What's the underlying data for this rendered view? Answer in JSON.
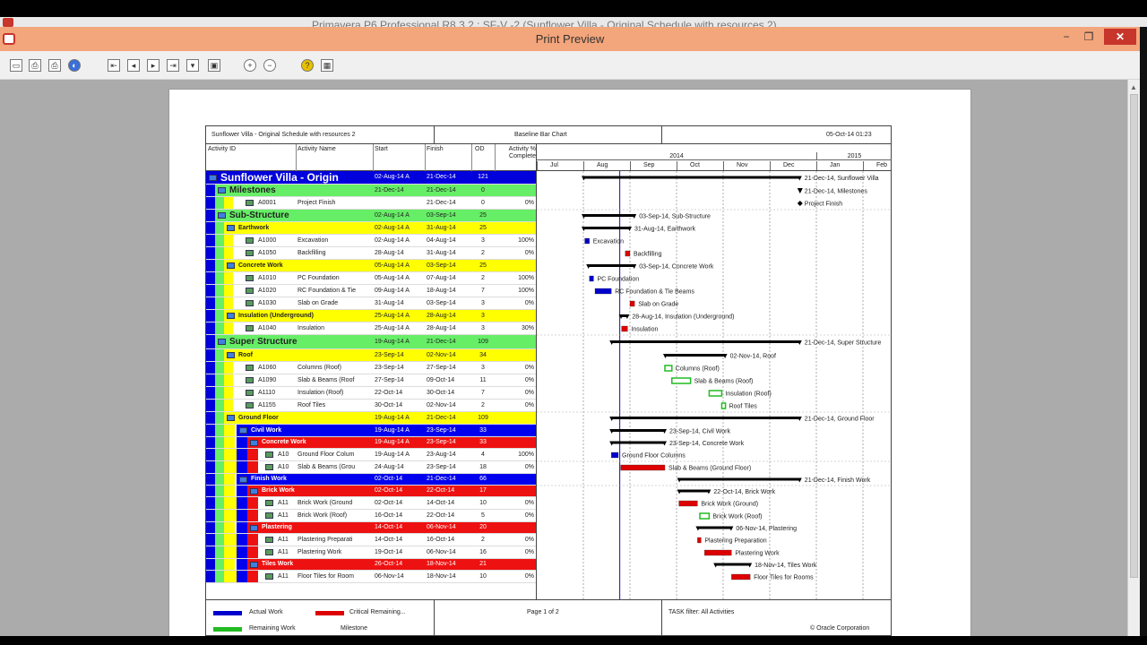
{
  "window": {
    "background_title": "Primavera P6 Professional R8.3.2 : SF-V -2 (Sunflower Villa - Original Schedule with resources 2)",
    "title": "Print Preview",
    "min_label": "−",
    "max_label": "❐",
    "close_label": "✕"
  },
  "toolbar": {
    "buttons": [
      "page-setup",
      "print-setup",
      "print",
      "publish",
      "first-page",
      "previous-page",
      "next-page",
      "last-page",
      "page-down",
      "zoom-in",
      "zoom-out",
      "help",
      "options"
    ]
  },
  "colors": {
    "band_project": "#0000dd",
    "band_wbs1": "#66ee66",
    "band_wbs2": "#ffff00",
    "band_wbs3": "#0000ee",
    "band_wbs4": "#ee1111",
    "bar_actual": "#0000cc",
    "bar_critical": "#dd0000",
    "bar_remaining": "#22bb22",
    "summary_bar": "#000000"
  },
  "report": {
    "header_left": "Sunflower Villa - Original Schedule with resources 2",
    "header_center": "Baseline Bar Chart",
    "header_right": "05-Oct-14 01:23",
    "columns": {
      "activity_id": "Activity ID",
      "activity_name": "Activity Name",
      "start": "Start",
      "finish": "Finish",
      "od": "OD",
      "pct": "Activity % Complete"
    },
    "timeline": {
      "years": [
        {
          "label": "2014"
        },
        {
          "label": "2015"
        }
      ],
      "months": [
        "Jul",
        "Aug",
        "Sep",
        "Oct",
        "Nov",
        "Dec",
        "Jan",
        "Feb"
      ]
    },
    "rows": [
      {
        "type": "project",
        "id": "",
        "name": "Sunflower Villa - Origin",
        "start": "02-Aug-14 A",
        "finish": "21-Dec-14",
        "od": "121",
        "pct": "",
        "bar": {
          "kind": "summary",
          "s": 1.0,
          "e": 5.65
        },
        "label": "21-Dec-14, Sunflower Villa"
      },
      {
        "type": "wbs1",
        "id": "",
        "name": "Milestones",
        "start": "21-Dec-14",
        "finish": "21-Dec-14",
        "od": "0",
        "pct": "",
        "bar": {
          "kind": "milestone-summary",
          "s": 5.65
        },
        "label": "21-Dec-14, Milestones"
      },
      {
        "type": "act",
        "id": "A0001",
        "name": "Project Finish",
        "start": "",
        "finish": "21-Dec-14",
        "od": "0",
        "pct": "0%",
        "bar": {
          "kind": "milestone",
          "s": 5.65
        },
        "label": "Project Finish"
      },
      {
        "type": "wbs1",
        "id": "",
        "name": "Sub-Structure",
        "start": "02-Aug-14 A",
        "finish": "03-Sep-14",
        "od": "25",
        "pct": "",
        "bar": {
          "kind": "summary",
          "s": 1.0,
          "e": 2.1
        },
        "label": "03-Sep-14, Sub-Structure"
      },
      {
        "type": "wbs2",
        "id": "",
        "name": "Earthwork",
        "start": "02-Aug-14 A",
        "finish": "31-Aug-14",
        "od": "25",
        "pct": "",
        "bar": {
          "kind": "summary",
          "s": 1.0,
          "e": 2.0
        },
        "label": "31-Aug-14, Earthwork"
      },
      {
        "type": "act",
        "id": "A1000",
        "name": "Excavation",
        "start": "02-Aug-14 A",
        "finish": "04-Aug-14",
        "od": "3",
        "pct": "100%",
        "bar": {
          "kind": "actual",
          "s": 1.03,
          "e": 1.13
        },
        "label": "Excavation"
      },
      {
        "type": "act",
        "id": "A1050",
        "name": "Backfilling",
        "start": "28-Aug-14",
        "finish": "31-Aug-14",
        "od": "2",
        "pct": "0%",
        "bar": {
          "kind": "critical",
          "s": 1.9,
          "e": 2.0
        },
        "label": "Backfilling"
      },
      {
        "type": "wbs2",
        "id": "",
        "name": "Concrete Work",
        "start": "05-Aug-14 A",
        "finish": "03-Sep-14",
        "od": "25",
        "pct": "",
        "bar": {
          "kind": "summary",
          "s": 1.1,
          "e": 2.1
        },
        "label": "03-Sep-14, Concrete Work"
      },
      {
        "type": "act",
        "id": "A1010",
        "name": "PC Foundation",
        "start": "05-Aug-14 A",
        "finish": "07-Aug-14",
        "od": "2",
        "pct": "100%",
        "bar": {
          "kind": "actual",
          "s": 1.13,
          "e": 1.22
        },
        "label": "PC Foundation"
      },
      {
        "type": "act",
        "id": "A1020",
        "name": "RC Foundation & Tie",
        "start": "09-Aug-14 A",
        "finish": "18-Aug-14",
        "od": "7",
        "pct": "100%",
        "bar": {
          "kind": "actual",
          "s": 1.25,
          "e": 1.6
        },
        "label": "RC Foundation & Tie Beams"
      },
      {
        "type": "act",
        "id": "A1030",
        "name": "Slab on Grade",
        "start": "31-Aug-14",
        "finish": "03-Sep-14",
        "od": "3",
        "pct": "0%",
        "bar": {
          "kind": "critical",
          "s": 2.0,
          "e": 2.1
        },
        "label": "Slab on Grade"
      },
      {
        "type": "wbs2",
        "id": "",
        "name": "Insulation (Underground)",
        "start": "25-Aug-14 A",
        "finish": "28-Aug-14",
        "od": "3",
        "pct": "",
        "bar": {
          "kind": "summary",
          "s": 1.8,
          "e": 1.95
        },
        "label": "28-Aug-14, Insulation (Underground)"
      },
      {
        "type": "act",
        "id": "A1040",
        "name": "Insulation",
        "start": "25-Aug-14 A",
        "finish": "28-Aug-14",
        "od": "3",
        "pct": "30%",
        "bar": {
          "kind": "critical",
          "s": 1.82,
          "e": 1.95
        },
        "label": "Insulation"
      },
      {
        "type": "wbs1",
        "id": "",
        "name": "Super Structure",
        "start": "19-Aug-14 A",
        "finish": "21-Dec-14",
        "od": "109",
        "pct": "",
        "bar": {
          "kind": "summary",
          "s": 1.6,
          "e": 5.65
        },
        "label": "21-Dec-14, Super Structure"
      },
      {
        "type": "wbs2",
        "id": "",
        "name": "Roof",
        "start": "23-Sep-14",
        "finish": "02-Nov-14",
        "od": "34",
        "pct": "",
        "bar": {
          "kind": "summary",
          "s": 2.75,
          "e": 4.05
        },
        "label": "02-Nov-14, Roof"
      },
      {
        "type": "act",
        "id": "A1060",
        "name": "Columns (Roof)",
        "start": "23-Sep-14",
        "finish": "27-Sep-14",
        "od": "3",
        "pct": "0%",
        "bar": {
          "kind": "remaining",
          "s": 2.75,
          "e": 2.9
        },
        "label": "Columns (Roof)"
      },
      {
        "type": "act",
        "id": "A1090",
        "name": "Slab & Beams (Roof",
        "start": "27-Sep-14",
        "finish": "09-Oct-14",
        "od": "11",
        "pct": "0%",
        "bar": {
          "kind": "remaining",
          "s": 2.9,
          "e": 3.3
        },
        "label": "Slab & Beams (Roof)"
      },
      {
        "type": "act",
        "id": "A1110",
        "name": "Insulation (Roof)",
        "start": "22-Oct-14",
        "finish": "30-Oct-14",
        "od": "7",
        "pct": "0%",
        "bar": {
          "kind": "remaining",
          "s": 3.7,
          "e": 3.97
        },
        "label": "Insulation (Roof)"
      },
      {
        "type": "act",
        "id": "A1155",
        "name": "Roof Tiles",
        "start": "30-Oct-14",
        "finish": "02-Nov-14",
        "od": "2",
        "pct": "0%",
        "bar": {
          "kind": "remaining",
          "s": 3.97,
          "e": 4.05
        },
        "label": "Roof Tiles"
      },
      {
        "type": "wbs2",
        "id": "",
        "name": "Ground Floor",
        "start": "19-Aug-14 A",
        "finish": "21-Dec-14",
        "od": "109",
        "pct": "",
        "bar": {
          "kind": "summary",
          "s": 1.6,
          "e": 5.65
        },
        "label": "21-Dec-14, Ground Floor"
      },
      {
        "type": "wbs3",
        "id": "",
        "name": "Civil Work",
        "start": "19-Aug-14 A",
        "finish": "23-Sep-14",
        "od": "33",
        "pct": "",
        "bar": {
          "kind": "summary",
          "s": 1.6,
          "e": 2.75
        },
        "label": "23-Sep-14, Civil Work"
      },
      {
        "type": "wbs4",
        "id": "",
        "name": "Concrete Work",
        "start": "19-Aug-14 A",
        "finish": "23-Sep-14",
        "od": "33",
        "pct": "",
        "bar": {
          "kind": "summary",
          "s": 1.6,
          "e": 2.75
        },
        "label": "23-Sep-14, Concrete Work"
      },
      {
        "type": "act2",
        "id": "A10",
        "name": "Ground Floor Colum",
        "start": "19-Aug-14 A",
        "finish": "23-Aug-14",
        "od": "4",
        "pct": "100%",
        "bar": {
          "kind": "actual",
          "s": 1.6,
          "e": 1.75
        },
        "label": "Ground Floor Columns"
      },
      {
        "type": "act2",
        "id": "A10",
        "name": "Slab & Beams (Grou",
        "start": "24-Aug-14",
        "finish": "23-Sep-14",
        "od": "18",
        "pct": "0%",
        "bar": {
          "kind": "critical",
          "s": 1.8,
          "e": 2.75
        },
        "label": "Slab & Beams (Ground Floor)"
      },
      {
        "type": "wbs3",
        "id": "",
        "name": "Finish Work",
        "start": "02-Oct-14",
        "finish": "21-Dec-14",
        "od": "66",
        "pct": "",
        "bar": {
          "kind": "summary",
          "s": 3.05,
          "e": 5.65
        },
        "label": "21-Dec-14, Finish Work"
      },
      {
        "type": "wbs4",
        "id": "",
        "name": "Brick Work",
        "start": "02-Oct-14",
        "finish": "22-Oct-14",
        "od": "17",
        "pct": "",
        "bar": {
          "kind": "summary",
          "s": 3.05,
          "e": 3.7
        },
        "label": "22-Oct-14, Brick Work"
      },
      {
        "type": "act2",
        "id": "A11",
        "name": "Brick Work (Ground",
        "start": "02-Oct-14",
        "finish": "14-Oct-14",
        "od": "10",
        "pct": "0%",
        "bar": {
          "kind": "critical",
          "s": 3.05,
          "e": 3.45
        },
        "label": "Brick Work (Ground)"
      },
      {
        "type": "act2",
        "id": "A11",
        "name": "Brick Work (Roof)",
        "start": "16-Oct-14",
        "finish": "22-Oct-14",
        "od": "5",
        "pct": "0%",
        "bar": {
          "kind": "remaining",
          "s": 3.5,
          "e": 3.7
        },
        "label": "Brick Work (Roof)"
      },
      {
        "type": "wbs4",
        "id": "",
        "name": "Plastering",
        "start": "14-Oct-14",
        "finish": "06-Nov-14",
        "od": "20",
        "pct": "",
        "bar": {
          "kind": "summary",
          "s": 3.45,
          "e": 4.18
        },
        "label": "06-Nov-14, Plastering"
      },
      {
        "type": "act2",
        "id": "A11",
        "name": "Plastering Preparati",
        "start": "14-Oct-14",
        "finish": "16-Oct-14",
        "od": "2",
        "pct": "0%",
        "bar": {
          "kind": "critical",
          "s": 3.45,
          "e": 3.52
        },
        "label": "Plastering Preparation"
      },
      {
        "type": "act2",
        "id": "A11",
        "name": "Plastering Work",
        "start": "19-Oct-14",
        "finish": "06-Nov-14",
        "od": "16",
        "pct": "0%",
        "bar": {
          "kind": "critical",
          "s": 3.6,
          "e": 4.18
        },
        "label": "Plastering Work"
      },
      {
        "type": "wbs4",
        "id": "",
        "name": "Tiles Work",
        "start": "26-Oct-14",
        "finish": "18-Nov-14",
        "od": "21",
        "pct": "",
        "bar": {
          "kind": "summary",
          "s": 3.83,
          "e": 4.58
        },
        "label": "18-Nov-14, Tiles Work"
      },
      {
        "type": "act2",
        "id": "A11",
        "name": "Floor Tiles for Room",
        "start": "06-Nov-14",
        "finish": "18-Nov-14",
        "od": "10",
        "pct": "0%",
        "bar": {
          "kind": "critical",
          "s": 4.18,
          "e": 4.58
        },
        "label": "Floor Tiles for Rooms"
      }
    ],
    "footer": {
      "legend": [
        {
          "label": "Actual Work",
          "color": "#0000cc"
        },
        {
          "label": "Critical Remaining...",
          "color": "#dd0000"
        },
        {
          "label": "Remaining Work",
          "color": "#22bb22"
        },
        {
          "label": "Milestone",
          "color": "#000000"
        }
      ],
      "page": "Page 1 of 2",
      "filter": "TASK filter: All Activities",
      "copyright": "© Oracle Corporation"
    }
  }
}
